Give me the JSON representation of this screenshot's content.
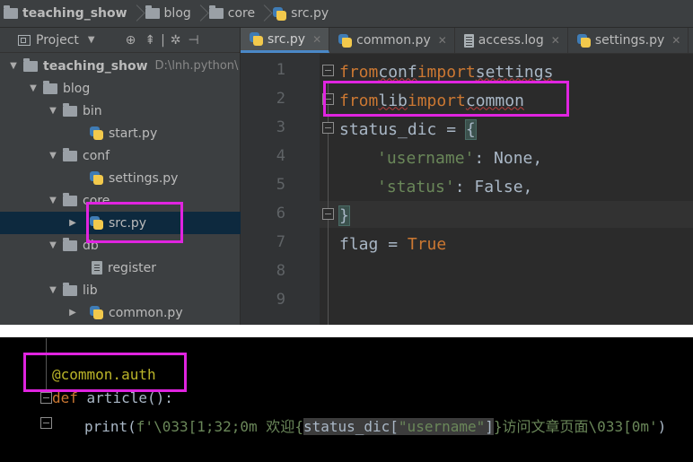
{
  "breadcrumb": {
    "items": [
      {
        "label": "teaching_show",
        "icon": "folder-icon"
      },
      {
        "label": "blog",
        "icon": "folder-icon"
      },
      {
        "label": "core",
        "icon": "folder-icon"
      },
      {
        "label": "src.py",
        "icon": "python-file-icon"
      }
    ]
  },
  "project_panel": {
    "title": "Project",
    "tree": [
      {
        "label": "teaching_show",
        "path": "D:\\lnh.python\\",
        "type": "folder",
        "expanded": true
      },
      {
        "label": "blog",
        "type": "folder",
        "expanded": true
      },
      {
        "label": "bin",
        "type": "folder",
        "expanded": true
      },
      {
        "label": "start.py",
        "type": "python"
      },
      {
        "label": "conf",
        "type": "folder",
        "expanded": true
      },
      {
        "label": "settings.py",
        "type": "python"
      },
      {
        "label": "core",
        "type": "folder",
        "expanded": true
      },
      {
        "label": "src.py",
        "type": "python",
        "selected": true
      },
      {
        "label": "db",
        "type": "folder",
        "expanded": true
      },
      {
        "label": "register",
        "type": "file"
      },
      {
        "label": "lib",
        "type": "folder",
        "expanded": true
      },
      {
        "label": "common.py",
        "type": "python"
      }
    ]
  },
  "editor_tabs": [
    {
      "label": "src.py",
      "active": true,
      "icon": "python-file-icon"
    },
    {
      "label": "common.py",
      "active": false,
      "icon": "python-file-icon"
    },
    {
      "label": "access.log",
      "active": false,
      "icon": "log-file-icon"
    },
    {
      "label": "settings.py",
      "active": false,
      "icon": "python-file-icon"
    }
  ],
  "editor": {
    "line_numbers": [
      "1",
      "2",
      "3",
      "4",
      "5",
      "6",
      "7",
      "8",
      "9"
    ],
    "lines": {
      "l1_kw1": "from",
      "l1_mod": "conf",
      "l1_kw2": "import",
      "l1_name": "settings",
      "l2_kw1": "from",
      "l2_mod": "lib",
      "l2_kw2": "import",
      "l2_name": "common",
      "l3_var": "status_dic",
      "l3_eq": " = ",
      "l3_brace": "{",
      "l4_key": "'username'",
      "l4_rest": ": None,",
      "l5_key": "'status'",
      "l5_rest": ": False,",
      "l6_brace": "}",
      "l7_var": "flag",
      "l7_eq": " = ",
      "l7_val": "True"
    }
  },
  "bottom_snippet": {
    "decorator": "@common.auth",
    "def_kw": "def",
    "func_sig": " article():",
    "print_kw": "print(",
    "fstr_prefix": "f'",
    "escape1": "\\033[1;32;0m ",
    "zh1": "欢迎",
    "brace_open": "{",
    "expr_var": "status_dic[",
    "expr_key": "\"username\"",
    "expr_close": "]",
    "brace_close": "}",
    "zh2": "访问文章页面",
    "escape2": "\\033[0m'",
    "call_close": ")"
  },
  "colors": {
    "highlight_box": "#e024e0",
    "keyword": "#cc7832",
    "string": "#6a8759",
    "text": "#a9b7c6"
  }
}
